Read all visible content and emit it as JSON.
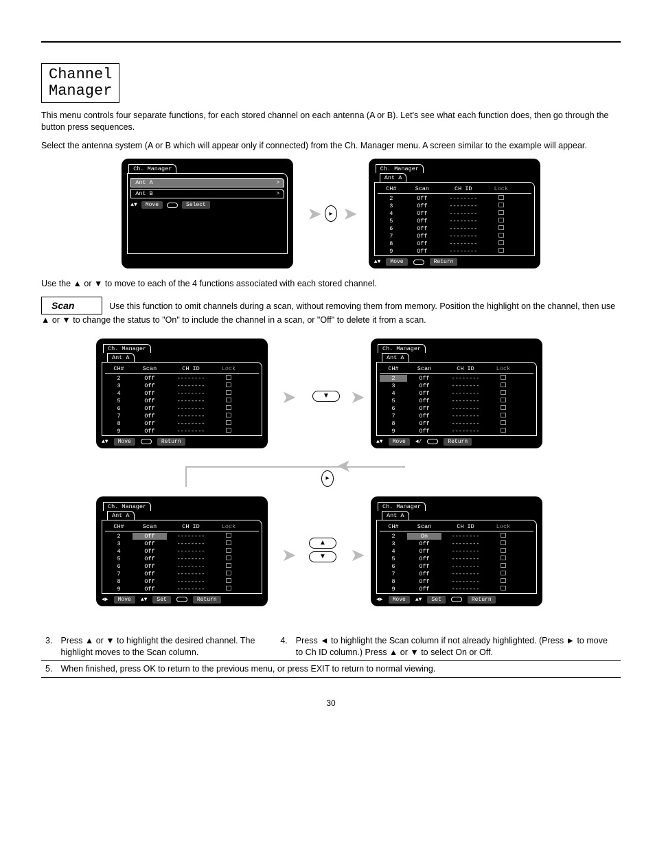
{
  "title_line1": "Channel",
  "title_line2": "Manager",
  "intro": "This menu controls four separate functions, for each stored channel on each antenna (A or B). Let's see what each function does, then go through the button press sequences.",
  "select_antenna_text": "Select the antenna system (A or B which will appear only if connected) from the Ch. Manager menu. A screen similar to the example will appear.",
  "move_para": "Use the ▲ or ▼ to move to each of the 4 functions associated with each stored channel.",
  "scan": {
    "label": "Scan",
    "desc": "Use this function to omit channels during a scan, without removing them from memory. Position the highlight on the channel, then use ▲ or ▼ to change the status to \"On\" to include the channel in a scan, or \"Off\" to delete it from a scan."
  },
  "steps": {
    "s3_num": "3.",
    "s3_text": "Press ▲ or ▼ to highlight the desired channel. The highlight moves to the Scan column.",
    "s4_num": "4.",
    "s4_text": "Press ◄ to highlight the Scan column if not already highlighted. (Press ► to move to Ch ID column.) Press ▲ or ▼ to select On or Off.",
    "s5_num": "5.",
    "s5_text": "When finished, press OK to return to the previous menu, or press EXIT to return to normal viewing."
  },
  "page_number": "30",
  "ui": {
    "screen_title": "Ch. Manager",
    "ant_a": "Ant A",
    "ant_b": "Ant B",
    "move": "Move",
    "select": "Select",
    "return": "Return",
    "set": "Set",
    "col_ch": "CH#",
    "col_scan": "Scan",
    "col_chid": "CH ID",
    "col_lock": "Lock",
    "chid_blank": "--------",
    "scan_on": "On",
    "scan_off": "Off",
    "channels": [
      "2",
      "3",
      "4",
      "5",
      "6",
      "7",
      "8",
      "9"
    ]
  }
}
